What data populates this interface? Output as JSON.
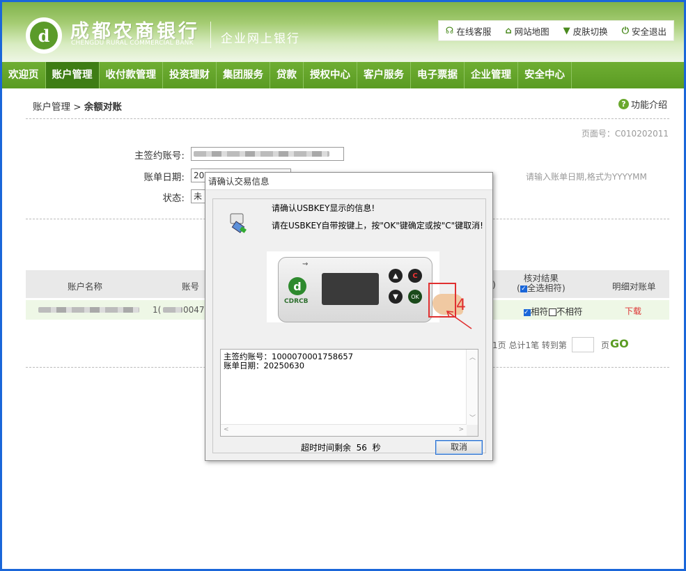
{
  "header": {
    "logo_glyph": "d",
    "bank_name_cn": "成都农商银行",
    "bank_name_en": "CHENGDU RURAL COMMERCIAL BANK",
    "subtitle": "企业网上银行",
    "links": [
      {
        "icon": "headset-icon",
        "glyph": "☊",
        "label": "在线客服"
      },
      {
        "icon": "home-icon",
        "glyph": "⌂",
        "label": "网站地图"
      },
      {
        "icon": "shirt-icon",
        "glyph": "👕",
        "label": "皮肤切换"
      },
      {
        "icon": "power-icon",
        "glyph": "⏻",
        "label": "安全退出"
      }
    ]
  },
  "nav": {
    "items": [
      "欢迎页",
      "账户管理",
      "收付款管理",
      "投资理财",
      "集团服务",
      "贷款",
      "授权中心",
      "客户服务",
      "电子票据",
      "企业管理",
      "安全中心"
    ],
    "active_index": 1
  },
  "breadcrumb": {
    "parent": "账户管理",
    "sep": " > ",
    "current": "余额对账"
  },
  "help_label": "功能介绍",
  "page_no": "页面号：C010202011",
  "form": {
    "account_label": "主签约账号:",
    "date_label": "账单日期:",
    "date_value": "202",
    "status_label": "状态:",
    "status_value": "未",
    "date_hint": "请输入账单日期,格式为YYYYMM"
  },
  "table": {
    "headers": [
      "账户名称",
      "账号",
      ")",
      "核对结果",
      "明细对账单"
    ],
    "select_all_label": "全选相符",
    "row": {
      "account_prefix": "1(",
      "account_mid": "0047",
      "match_label": "相符",
      "mismatch_label": "不相符",
      "download": "下载"
    }
  },
  "pager": {
    "text": "1页 总计1笔 转到第",
    "page_suffix": "页",
    "go": "GO"
  },
  "dialog": {
    "title": "请确认交易信息",
    "msg1": "请确认USBKEY显示的信息!",
    "msg2": "请在USBKEY自带按键上，按\"OK\"键确定或按\"C\"键取消!",
    "device": {
      "brand": "CDRCB",
      "logo_glyph": "d",
      "usb_symbol": "⇝",
      "button_c": "C",
      "button_up": "▲",
      "button_down": "▼",
      "button_ok": "OK"
    },
    "annotation_number": "4",
    "info_line1": "主签约账号：1000070001758657",
    "info_line2": "账单日期：20250630",
    "timeout_label": "超时时间剩余",
    "timeout_value": "56",
    "timeout_unit": "秒",
    "cancel": "取消"
  },
  "colors": {
    "brand_green": "#5a9b22",
    "nav_active": "#3e7d14",
    "annotation_red": "#e03030",
    "frame_blue": "#1a66d9"
  }
}
